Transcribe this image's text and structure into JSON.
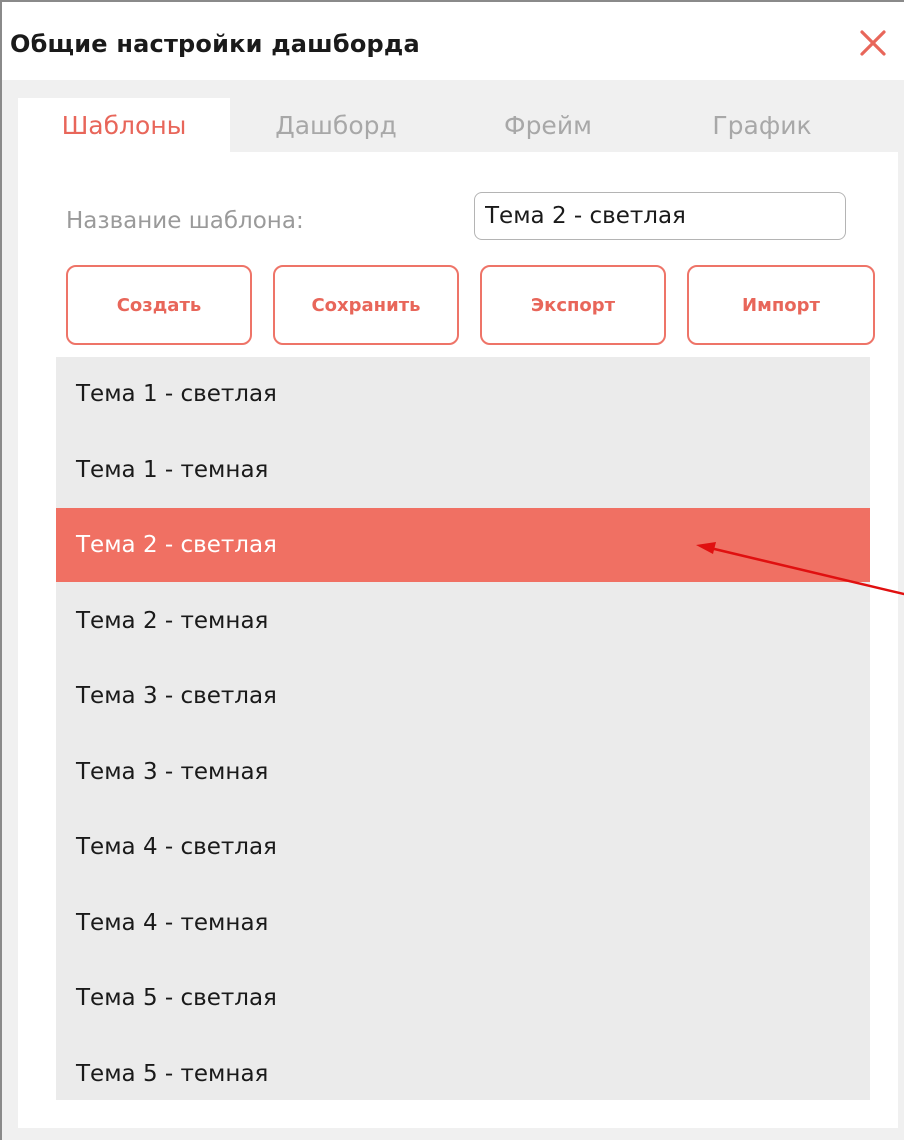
{
  "dialog": {
    "title": "Общие настройки дашборда",
    "close_icon": "close-x-icon"
  },
  "tabs": [
    {
      "label": "Шаблоны",
      "active": true
    },
    {
      "label": "Дашборд",
      "active": false
    },
    {
      "label": "Фрейм",
      "active": false
    },
    {
      "label": "График",
      "active": false
    }
  ],
  "template_name": {
    "label": "Название шаблона:",
    "value": "Тема 2 - светлая"
  },
  "buttons": {
    "create": "Создать",
    "save": "Сохранить",
    "export": "Экспорт",
    "import": "Импорт"
  },
  "templates": {
    "items": [
      "Тема 1 - светлая",
      "Тема 1 - темная",
      "Тема 2 - светлая",
      "Тема 2 - темная",
      "Тема 3 - светлая",
      "Тема 3 - темная",
      "Тема 4 - светлая",
      "Тема 4 - темная",
      "Тема 5 - светлая",
      "Тема 5 - темная"
    ],
    "selected": "Тема 2 - светлая"
  },
  "colors": {
    "accent": "#e8665a",
    "selected_row": "#f07063",
    "list_bg": "#ebebeb",
    "annotation_arrow": "#e01010"
  }
}
